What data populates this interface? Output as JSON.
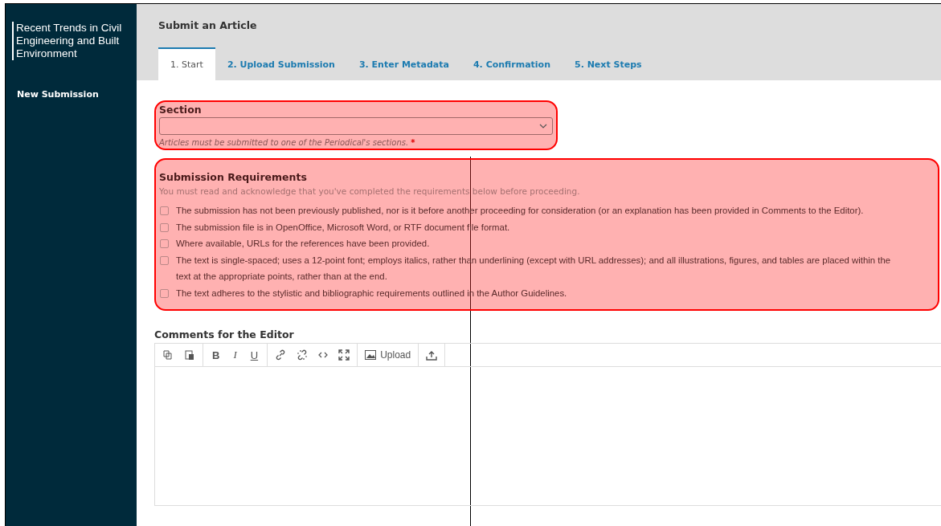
{
  "sidebar": {
    "journal_title": "Recent Trends in Civil Engineering and Built Environment",
    "items": [
      {
        "label": "New Submission",
        "selected": true
      }
    ]
  },
  "page_title": "Submit an Article",
  "tabs": [
    {
      "label": "1. Start",
      "selected": true
    },
    {
      "label": "2. Upload Submission",
      "selected": false
    },
    {
      "label": "3. Enter Metadata",
      "selected": false
    },
    {
      "label": "4. Confirmation",
      "selected": false
    },
    {
      "label": "5. Next Steps",
      "selected": false
    }
  ],
  "section": {
    "highlighted": true,
    "label": "Section",
    "help": "Articles must be submitted to one of the Periodical's sections.",
    "required_mark": "*"
  },
  "requirements": {
    "highlighted": true,
    "title": "Submission Requirements",
    "intro": "You must read and acknowledge that you've completed the requirements below before proceeding.",
    "items": [
      {
        "text": "The submission has not been previously published, nor is it before another proceeding for consideration (or an explanation has been provided in Comments to the Editor).",
        "checked": false
      },
      {
        "text": "The submission file is in OpenOffice, Microsoft Word, or RTF document file format.",
        "checked": false
      },
      {
        "text": "Where available, URLs for the references have been provided.",
        "checked": false
      },
      {
        "text": "The text is single-spaced; uses a 12-point font; employs italics, rather than underlining (except with URL addresses); and all illustrations, figures, and tables are placed within the text at the appropriate points, rather than at the end.",
        "checked": false
      },
      {
        "text": "The text adheres to the stylistic and bibliographic requirements outlined in the Author Guidelines.",
        "checked": false
      }
    ]
  },
  "comments": {
    "label": "Comments for the Editor",
    "format_buttons": [
      "B",
      "I",
      "U"
    ],
    "upload_label": "Upload"
  },
  "pointer_line": true
}
